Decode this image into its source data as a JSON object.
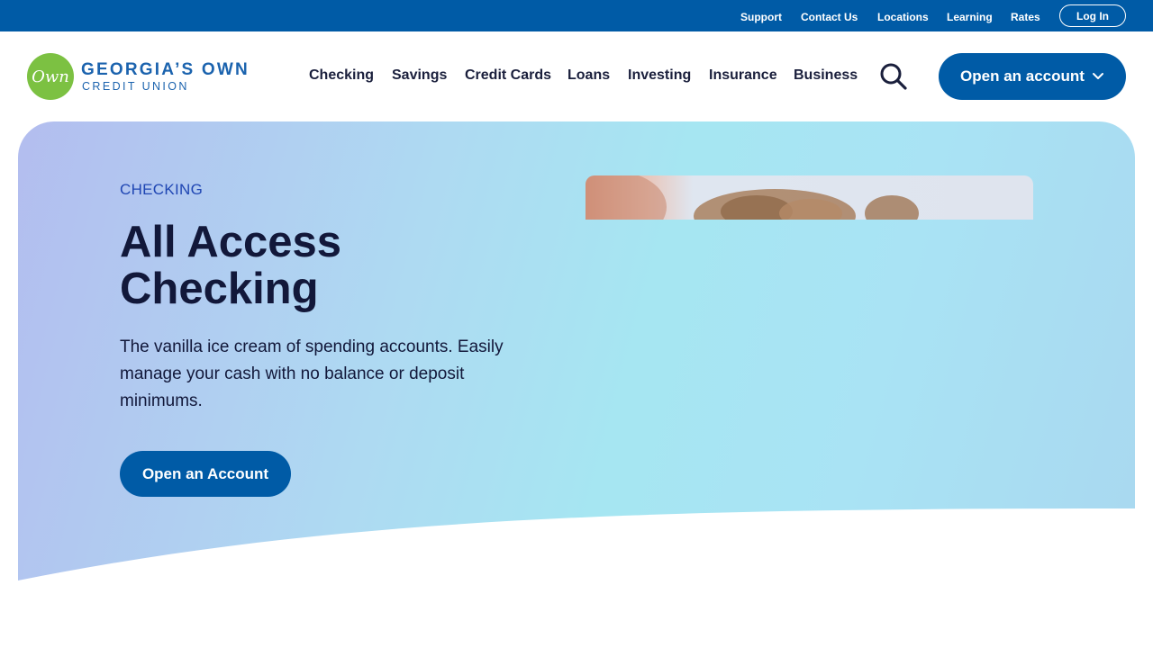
{
  "utility": {
    "links": [
      "Support",
      "Contact Us",
      "Locations",
      "Learning",
      "Rates"
    ],
    "login_label": "Log In"
  },
  "brand": {
    "mark": "Own",
    "name_line1": "GEORGIA’S OWN",
    "name_line2": "CREDIT UNION",
    "color": "#1b63ae",
    "mark_color": "#7cc142"
  },
  "nav": {
    "items": [
      "Checking",
      "Savings",
      "Credit Cards",
      "Loans",
      "Investing",
      "Insurance",
      "Business"
    ],
    "search_icon": "search-icon",
    "open_account_label": "Open an account",
    "open_account_icon": "chevron-down-icon"
  },
  "hero": {
    "eyebrow": "CHECKING",
    "title": "All Access Checking",
    "description": "The vanilla ice cream of spending accounts. Easily manage your cash with no balance or deposit minimums.",
    "cta_label": "Open an Account"
  },
  "colors": {
    "primary": "#005ba6",
    "eyebrow": "#1f46b3",
    "text_dark": "#12183a"
  }
}
